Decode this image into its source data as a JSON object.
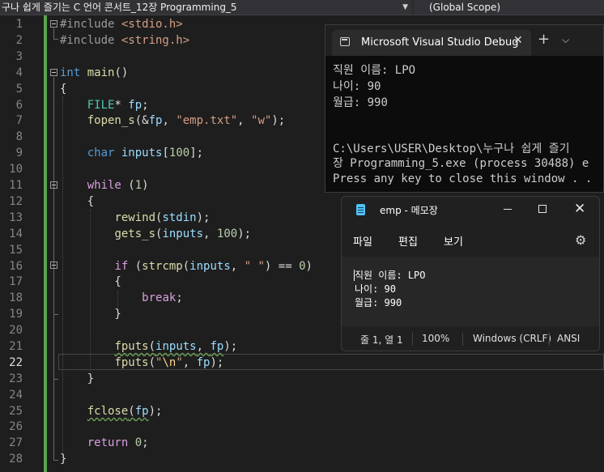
{
  "nav": {
    "file_scope": "구나 쉽게 즐기는 C 언어 콘서트_12장 Programming_5",
    "global_scope": "(Global Scope)"
  },
  "editor": {
    "current_line": 22,
    "line_numbers": [
      "1",
      "2",
      "3",
      "4",
      "5",
      "6",
      "7",
      "8",
      "9",
      "10",
      "11",
      "12",
      "13",
      "14",
      "15",
      "16",
      "17",
      "18",
      "19",
      "20",
      "21",
      "22",
      "23",
      "24",
      "25",
      "26",
      "27",
      "28"
    ],
    "lines": [
      [
        [
          "pp",
          "#include "
        ],
        [
          "str",
          "<stdio.h>"
        ]
      ],
      [
        [
          "pp",
          "#include "
        ],
        [
          "str",
          "<string.h>"
        ]
      ],
      [],
      [
        [
          "kw",
          "int"
        ],
        [
          "plain",
          " "
        ],
        [
          "fn",
          "main"
        ],
        [
          "plain",
          "()"
        ]
      ],
      [
        [
          "plain",
          "{"
        ]
      ],
      [
        [
          "plain",
          "    "
        ],
        [
          "typ",
          "FILE"
        ],
        [
          "plain",
          "* "
        ],
        [
          "var",
          "fp"
        ],
        [
          "plain",
          ";"
        ]
      ],
      [
        [
          "plain",
          "    "
        ],
        [
          "fn",
          "fopen_s"
        ],
        [
          "plain",
          "(&"
        ],
        [
          "var",
          "fp"
        ],
        [
          "plain",
          ", "
        ],
        [
          "str",
          "\"emp.txt\""
        ],
        [
          "plain",
          ", "
        ],
        [
          "str",
          "\"w\""
        ],
        [
          "plain",
          ");"
        ]
      ],
      [],
      [
        [
          "plain",
          "    "
        ],
        [
          "kw",
          "char"
        ],
        [
          "plain",
          " "
        ],
        [
          "var",
          "inputs"
        ],
        [
          "plain",
          "["
        ],
        [
          "num",
          "100"
        ],
        [
          "plain",
          "];"
        ]
      ],
      [],
      [
        [
          "plain",
          "    "
        ],
        [
          "ctl",
          "while"
        ],
        [
          "plain",
          " ("
        ],
        [
          "num",
          "1"
        ],
        [
          "plain",
          ")"
        ]
      ],
      [
        [
          "plain",
          "    {"
        ]
      ],
      [
        [
          "plain",
          "        "
        ],
        [
          "fn",
          "rewind"
        ],
        [
          "plain",
          "("
        ],
        [
          "var",
          "stdin"
        ],
        [
          "plain",
          ");"
        ]
      ],
      [
        [
          "plain",
          "        "
        ],
        [
          "fn",
          "gets_s"
        ],
        [
          "plain",
          "("
        ],
        [
          "var",
          "inputs"
        ],
        [
          "plain",
          ", "
        ],
        [
          "num",
          "100"
        ],
        [
          "plain",
          ");"
        ]
      ],
      [],
      [
        [
          "plain",
          "        "
        ],
        [
          "ctl",
          "if"
        ],
        [
          "plain",
          " ("
        ],
        [
          "fn",
          "strcmp"
        ],
        [
          "plain",
          "("
        ],
        [
          "var",
          "inputs"
        ],
        [
          "plain",
          ", "
        ],
        [
          "str",
          "\" \""
        ],
        [
          "plain",
          ") == "
        ],
        [
          "num",
          "0"
        ],
        [
          "plain",
          ")"
        ]
      ],
      [
        [
          "plain",
          "        {"
        ]
      ],
      [
        [
          "plain",
          "            "
        ],
        [
          "ctl",
          "break"
        ],
        [
          "plain",
          ";"
        ]
      ],
      [
        [
          "plain",
          "        }"
        ]
      ],
      [],
      [
        [
          "plain",
          "        "
        ],
        [
          "fn squig",
          "fputs"
        ],
        [
          "plain squig",
          "("
        ],
        [
          "var squig",
          "inputs"
        ],
        [
          "plain squig",
          ", "
        ],
        [
          "var squig",
          "fp"
        ],
        [
          "plain",
          ");"
        ]
      ],
      [
        [
          "plain",
          "        "
        ],
        [
          "fn",
          "fputs"
        ],
        [
          "plain",
          "("
        ],
        [
          "str",
          "\""
        ],
        [
          "esc",
          "\\n"
        ],
        [
          "str",
          "\""
        ],
        [
          "plain",
          ", "
        ],
        [
          "var",
          "fp"
        ],
        [
          "plain",
          ");"
        ]
      ],
      [
        [
          "plain",
          "    }"
        ]
      ],
      [],
      [
        [
          "plain",
          "    "
        ],
        [
          "fn squig",
          "fclose"
        ],
        [
          "plain squig",
          "("
        ],
        [
          "var squig",
          "fp"
        ],
        [
          "plain",
          ");"
        ]
      ],
      [],
      [
        [
          "plain",
          "    "
        ],
        [
          "ctl",
          "return"
        ],
        [
          "plain",
          " "
        ],
        [
          "num",
          "0"
        ],
        [
          "plain",
          ";"
        ]
      ],
      [
        [
          "plain",
          "}"
        ]
      ]
    ]
  },
  "console": {
    "tab_title": "Microsoft Visual Studio Debug",
    "close_glyph": "✕",
    "new_tab_glyph": "+",
    "dropdown_glyph": "⌵",
    "output": [
      "직원 이름: LPO",
      "나이: 90",
      "월급: 990",
      "",
      "",
      "C:\\Users\\USER\\Desktop\\누구나 쉽게 즐기",
      "장 Programming_5.exe (process 30488) e",
      "Press any key to close this window . ."
    ]
  },
  "notepad": {
    "title": "emp - 메모장",
    "menu": [
      "파일",
      "편집",
      "보기"
    ],
    "content": [
      "직원 이름: LPO",
      "나이: 90",
      "월급: 990"
    ],
    "status": {
      "position": "줄 1, 열 1",
      "zoom": "100%",
      "line_ending": "Windows (CRLF)",
      "encoding": "ANSI"
    },
    "minimize_icon": "minimize-icon",
    "maximize_icon": "maximize-icon",
    "close_glyph": "✕",
    "settings_glyph": "⚙"
  }
}
